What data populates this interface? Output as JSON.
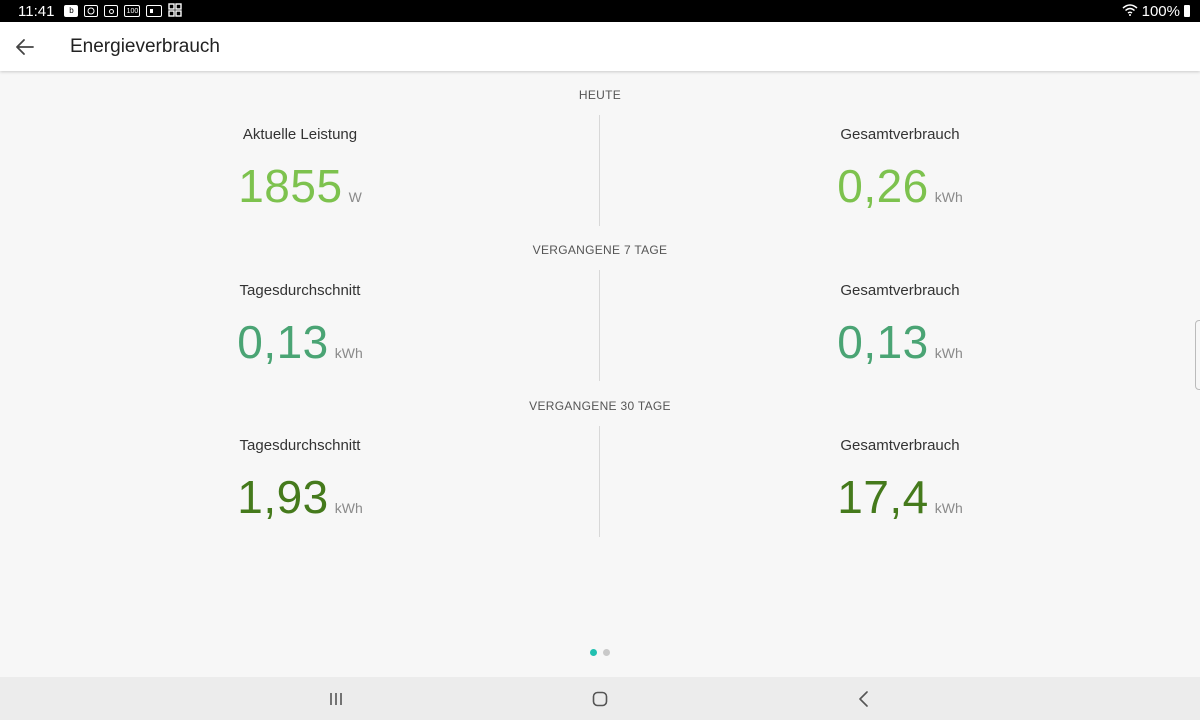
{
  "status_bar": {
    "time": "11:41",
    "icons": [
      "b-icon",
      "messenger-icon",
      "camera-icon",
      "badge-100-icon",
      "card-icon",
      "grid-icon"
    ],
    "badge_100": "100",
    "battery": "100%"
  },
  "app_bar": {
    "title": "Energieverbrauch"
  },
  "sections": [
    {
      "header": "HEUTE",
      "left": {
        "label": "Aktuelle Leistung",
        "value": "1855",
        "unit": "W"
      },
      "right": {
        "label": "Gesamtverbrauch",
        "value": "0,26",
        "unit": "kWh"
      },
      "color": "#7dc24e"
    },
    {
      "header": "VERGANGENE 7 TAGE",
      "left": {
        "label": "Tagesdurchschnitt",
        "value": "0,13",
        "unit": "kWh"
      },
      "right": {
        "label": "Gesamtverbrauch",
        "value": "0,13",
        "unit": "kWh"
      },
      "color": "#4aa474"
    },
    {
      "header": "VERGANGENE 30 TAGE",
      "left": {
        "label": "Tagesdurchschnitt",
        "value": "1,93",
        "unit": "kWh"
      },
      "right": {
        "label": "Gesamtverbrauch",
        "value": "17,4",
        "unit": "kWh"
      },
      "color": "#457a1c"
    }
  ],
  "pager": {
    "count": 2,
    "active": 0,
    "active_color": "#21c0b0"
  },
  "nav_bar": {
    "buttons": [
      "recents-icon",
      "home-icon",
      "back-icon"
    ]
  }
}
